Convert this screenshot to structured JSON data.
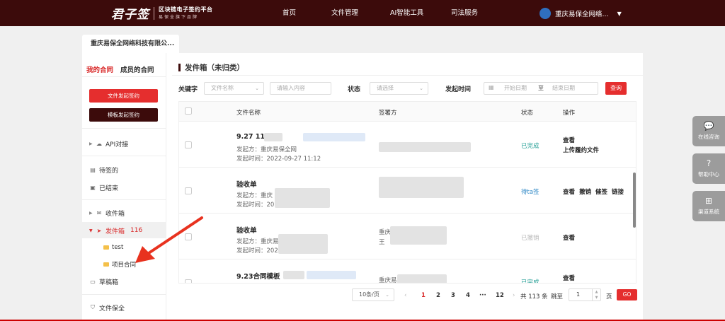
{
  "header": {
    "logo_mark": "君子签",
    "logo_line1": "区块链电子签约平台",
    "logo_line2": "易保全旗下品牌",
    "nav": [
      "首页",
      "文件管理",
      "AI智能工具",
      "司法服务"
    ],
    "user_name": "重庆易保全网络...",
    "caret": "▼"
  },
  "company_tab": "重庆易保全网络科技有限公...",
  "sidebar": {
    "tab_mine": "我的合同",
    "tab_members": "成员的合同",
    "btn_file_sign": "文件发起签约",
    "btn_template_sign": "模板发起签约",
    "api": "API对接",
    "pending": "待签的",
    "finished": "已结束",
    "inbox": "收件箱",
    "outbox": "发件箱",
    "outbox_count": "116",
    "folder_test": "test",
    "folder_project": "项目合同",
    "drafts": "草稿箱",
    "file_preserve": "文件保全"
  },
  "content": {
    "title": "发件箱（未归类）",
    "filter": {
      "keyword_label": "关键字",
      "keyword_select": "文件名称",
      "keyword_placeholder": "请输入内容",
      "status_label": "状态",
      "status_placeholder": "请选择",
      "date_label": "发起时间",
      "date_start": "开始日期",
      "date_to": "至",
      "date_end": "结束日期",
      "search": "查询"
    },
    "columns": {
      "name": "文件名称",
      "signer": "签署方",
      "status": "状态",
      "ops": "操作"
    },
    "rows": [
      {
        "title": "9.27 11",
        "sender": "发起方：重庆易保全网",
        "time": "发起时间：2022-09-27 11:12",
        "status": "已完成",
        "ops": [
          "查看",
          "上传履约文件"
        ]
      },
      {
        "title": "验收单",
        "sender": "发起方：重庆",
        "time": "发起时间：2022-",
        "status": "待ta签",
        "ops": [
          "查看",
          "撤销",
          "催签",
          "链接"
        ]
      },
      {
        "title": "验收单",
        "sender": "发起方：重庆易",
        "time": "发起时间：2022-",
        "signer_a": "重庆",
        "signer_b": "王",
        "status": "已撤销",
        "ops": [
          "查看"
        ]
      },
      {
        "title": "9.23合同模板",
        "signer_a": "重庆易",
        "status": "已完成",
        "ops": [
          "查看"
        ]
      }
    ],
    "pagination": {
      "page_size": "10条/页",
      "pages": [
        "1",
        "2",
        "3",
        "4",
        "···",
        "12"
      ],
      "prev": "‹",
      "next": "›",
      "total": "共 113 条",
      "jump_label": "跳至",
      "jump_value": "1",
      "page_unit": "页",
      "go": "GO"
    }
  },
  "float": {
    "consult": "在线咨询",
    "help": "帮助中心",
    "channel": "渠道系统"
  },
  "colors": {
    "brand_dark": "#3c0b0b",
    "accent_red": "#e52e2e",
    "status_done": "#2aa198",
    "status_wait": "#2b86c5"
  }
}
